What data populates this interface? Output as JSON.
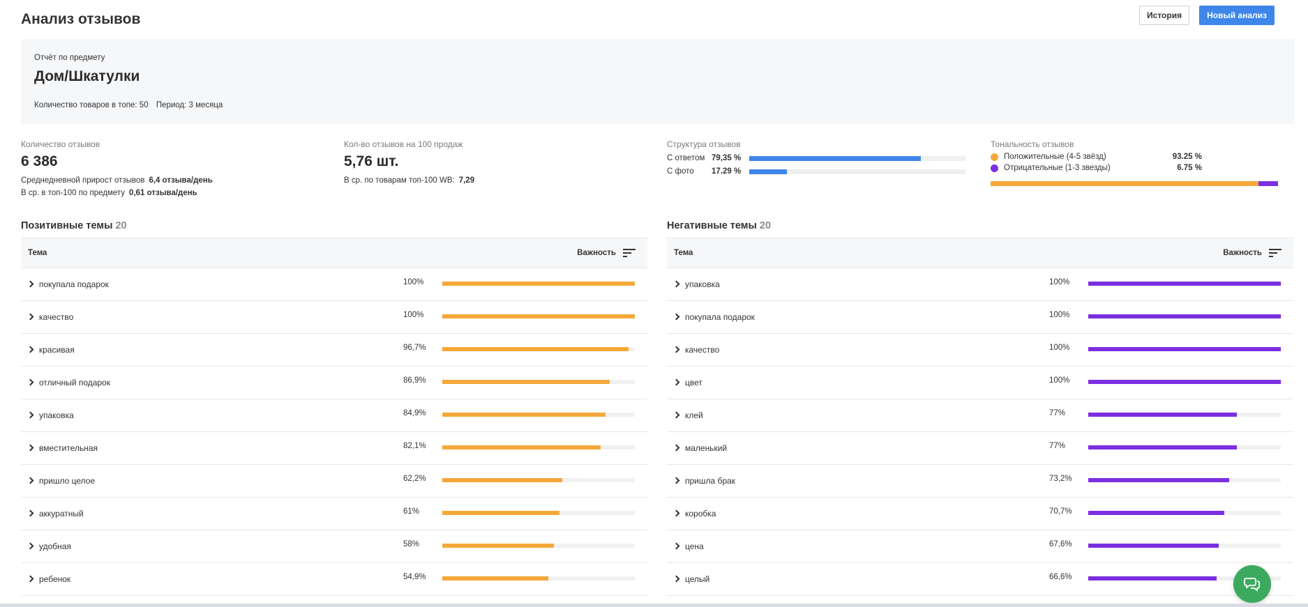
{
  "page": {
    "title": "Анализ отзывов",
    "history_button": "История",
    "new_analysis_button": "Новый анализ"
  },
  "subject": {
    "caption": "Отчёт по предмету",
    "name": "Дом/Шкатулки",
    "products_in_top": "Количество товаров в топе: 50",
    "period": "Период: 3 месяца"
  },
  "metrics": {
    "reviews_count": {
      "label": "Количество отзывов",
      "value": "6 386",
      "growth_label": "Среднедневной прирост отзывов",
      "growth_value": "6,4 отзыва/день",
      "top100_label": "В ср. в топ-100 по предмету",
      "top100_value": "0,61 отзыва/день"
    },
    "per_100_sales": {
      "label": "Кол-во отзывов на 100 продаж",
      "value": "5,76 шт.",
      "avg_label": "В ср. по товарам топ-100 WB:",
      "avg_value": "7,29"
    },
    "structure": {
      "label": "Структура отзывов",
      "rows": [
        {
          "name": "С ответом",
          "value": "79,35 %",
          "fraction": 0.7935
        },
        {
          "name": "С фото",
          "value": "17.29 %",
          "fraction": 0.1729
        }
      ]
    },
    "tone": {
      "label": "Тональность отзывов",
      "positive_label": "Положительные (4-5 звёзд)",
      "positive_value": "93.25 %",
      "positive_fraction": 0.9325,
      "negative_label": "Отрицательные (1-3 звезды)",
      "negative_value": "6.75 %",
      "negative_fraction": 0.0675
    }
  },
  "colors": {
    "positive": "#f5a83a",
    "negative": "#7b2fe0",
    "accent": "#3f86ea",
    "chat": "#3caa5e"
  },
  "positive_topics": {
    "title": "Позитивные темы",
    "count": "20",
    "col_topic": "Тема",
    "col_importance": "Важность",
    "rows": [
      {
        "label": "покупала подарок",
        "pct": "100%",
        "value": 100
      },
      {
        "label": "качество",
        "pct": "100%",
        "value": 100
      },
      {
        "label": "красивая",
        "pct": "96,7%",
        "value": 96.7
      },
      {
        "label": "отличный подарок",
        "pct": "86,9%",
        "value": 86.9
      },
      {
        "label": "упаковка",
        "pct": "84,9%",
        "value": 84.9
      },
      {
        "label": "вместительная",
        "pct": "82,1%",
        "value": 82.1
      },
      {
        "label": "пришло целое",
        "pct": "62,2%",
        "value": 62.2
      },
      {
        "label": "аккуратный",
        "pct": "61%",
        "value": 61
      },
      {
        "label": "удобная",
        "pct": "58%",
        "value": 58
      },
      {
        "label": "ребенок",
        "pct": "54,9%",
        "value": 54.9
      }
    ]
  },
  "negative_topics": {
    "title": "Негативные темы",
    "count": "20",
    "col_topic": "Тема",
    "col_importance": "Важность",
    "rows": [
      {
        "label": "упаковка",
        "pct": "100%",
        "value": 100
      },
      {
        "label": "покупала подарок",
        "pct": "100%",
        "value": 100
      },
      {
        "label": "качество",
        "pct": "100%",
        "value": 100
      },
      {
        "label": "цвет",
        "pct": "100%",
        "value": 100
      },
      {
        "label": "клей",
        "pct": "77%",
        "value": 77
      },
      {
        "label": "маленький",
        "pct": "77%",
        "value": 77
      },
      {
        "label": "пришла брак",
        "pct": "73,2%",
        "value": 73.2
      },
      {
        "label": "коробка",
        "pct": "70,7%",
        "value": 70.7
      },
      {
        "label": "цена",
        "pct": "67,6%",
        "value": 67.6
      },
      {
        "label": "целый",
        "pct": "66,6%",
        "value": 66.6
      }
    ]
  }
}
